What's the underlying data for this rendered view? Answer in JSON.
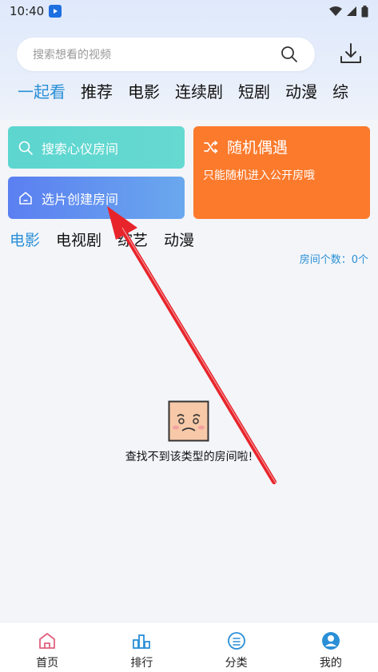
{
  "status_bar": {
    "time": "10:40"
  },
  "search": {
    "placeholder": "搜索想看的视频"
  },
  "top_tabs": [
    {
      "label": "一起看",
      "active": true
    },
    {
      "label": "推荐"
    },
    {
      "label": "电影"
    },
    {
      "label": "连续剧"
    },
    {
      "label": "短剧"
    },
    {
      "label": "动漫"
    },
    {
      "label": "综"
    }
  ],
  "cards": {
    "search_room": "搜索心仪房间",
    "create_room": "选片创建房间",
    "random_title": "随机偶遇",
    "random_subtitle": "只能随机进入公开房哦"
  },
  "category_tabs": [
    {
      "label": "电影",
      "active": true
    },
    {
      "label": "电视剧"
    },
    {
      "label": "综艺"
    },
    {
      "label": "动漫"
    }
  ],
  "room_count": "房间个数：0个",
  "empty_text": "查找不到该类型的房间啦!",
  "bottom_nav": [
    {
      "label": "首页",
      "icon": "home-icon",
      "active": true
    },
    {
      "label": "排行",
      "icon": "ranking-icon"
    },
    {
      "label": "分类",
      "icon": "category-icon"
    },
    {
      "label": "我的",
      "icon": "profile-icon"
    }
  ],
  "colors": {
    "accent": "#2a8fd6",
    "random_card": "#fb7a2c",
    "search_card": "#5dd6cf",
    "create_card": "#5b7ff1",
    "annotation_arrow": "#e8242b"
  }
}
